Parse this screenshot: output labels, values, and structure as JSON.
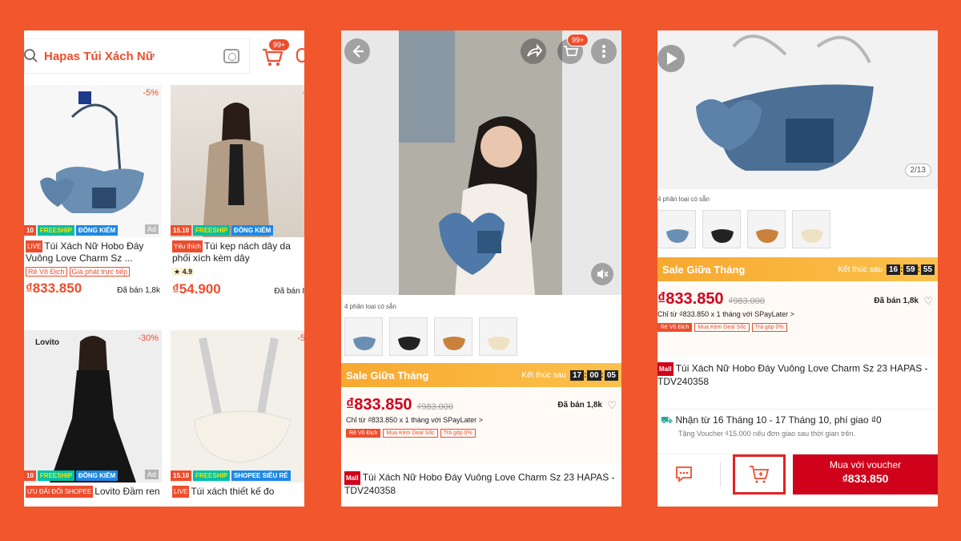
{
  "panel1": {
    "search_query": "Hapas Túi Xách Nữ",
    "cart_badge": "99+",
    "products": [
      {
        "discount": "-5%",
        "tags": [
          "10",
          "FREESHIP",
          "ĐỒNG KIỂM"
        ],
        "ad": "Ad",
        "live": "LIVE",
        "title": "Túi Xách Nữ Hobo Đáy Vuông Love Charm Sz ...",
        "chips": [
          "Rẻ Vô Địch",
          "Giá phát trực tiếp"
        ],
        "price": "₫833.850",
        "sold": "Đã bán 1,8k"
      },
      {
        "discount": "-",
        "tags": [
          "15.10",
          "FREESHIP",
          "ĐỒNG KIỂM"
        ],
        "favorite": "Yêu thích",
        "title": "Túi kẹp nách dây da phối xích kèm dây",
        "rating": "4.9",
        "price": "₫54.900",
        "sold": "Đã bán 8"
      },
      {
        "brand": "Lovito",
        "discount": "-30%",
        "tags": [
          "10",
          "FREESHIP",
          "ĐỒNG KIỂM"
        ],
        "ad": "Ad",
        "mall_tag": "ƯU ĐÃI ĐỐI SHOPEE",
        "title": "Lovito Đầm ren"
      },
      {
        "discount": "-5",
        "tags": [
          "15.10",
          "FREESHIP",
          "SHOPEE SIÊU RẺ"
        ],
        "live": "LIVE",
        "title": "Túi xách thiết kế đo"
      }
    ]
  },
  "panel2": {
    "cart_badge": "99+",
    "variant_label": "4 phân loại có sẵn",
    "sale_title": "Sale Giữa Tháng",
    "sale_ends": "Kết thúc sau",
    "timer": [
      "17",
      "00",
      "05"
    ],
    "price": "₫833.850",
    "old_price": "₫983.000",
    "sold": "Đã bán 1,8k",
    "spaylater": "Chỉ từ ₫833.850 x 1 tháng với SPayLater >",
    "chips": [
      "Rẻ Vô Địch",
      "Mua Kèm Deal Sốc",
      "Trả góp 0%"
    ],
    "mall": "Mall",
    "title": "Túi Xách Nữ Hobo Đáy Vuông Love Charm Sz 23 HAPAS - TDV240358"
  },
  "panel3": {
    "counter": "2/13",
    "variant_label": "4 phân loại có sẵn",
    "sale_title": "Sale Giữa Tháng",
    "sale_ends": "Kết thúc sau",
    "timer": [
      "16",
      "59",
      "55"
    ],
    "price": "₫833.850",
    "old_price": "₫983.000",
    "sold": "Đã bán 1,8k",
    "spaylater": "Chỉ từ ₫833.850 x 1 tháng với SPayLater >",
    "chips": [
      "Rẻ Vô Địch",
      "Mua Kèm Deal Sốc",
      "Trả góp 0%"
    ],
    "mall": "Mall",
    "title": "Túi Xách Nữ Hobo Đáy Vuông Love Charm Sz 23 HAPAS - TDV240358",
    "delivery": "Nhận từ 16 Tháng 10 - 17 Tháng 10, phí giao ₫0",
    "voucher_note": "Tặng Voucher ₫15.000 nếu đơn giao sau thời gian trên.",
    "buy_label": "Mua với voucher",
    "buy_price": "₫833.850"
  },
  "colors": {
    "background": "#f1562d",
    "shopee": "#ee4d2d",
    "price": "#d0011b",
    "sale": "#f7a930",
    "highlight": "#e32222"
  }
}
